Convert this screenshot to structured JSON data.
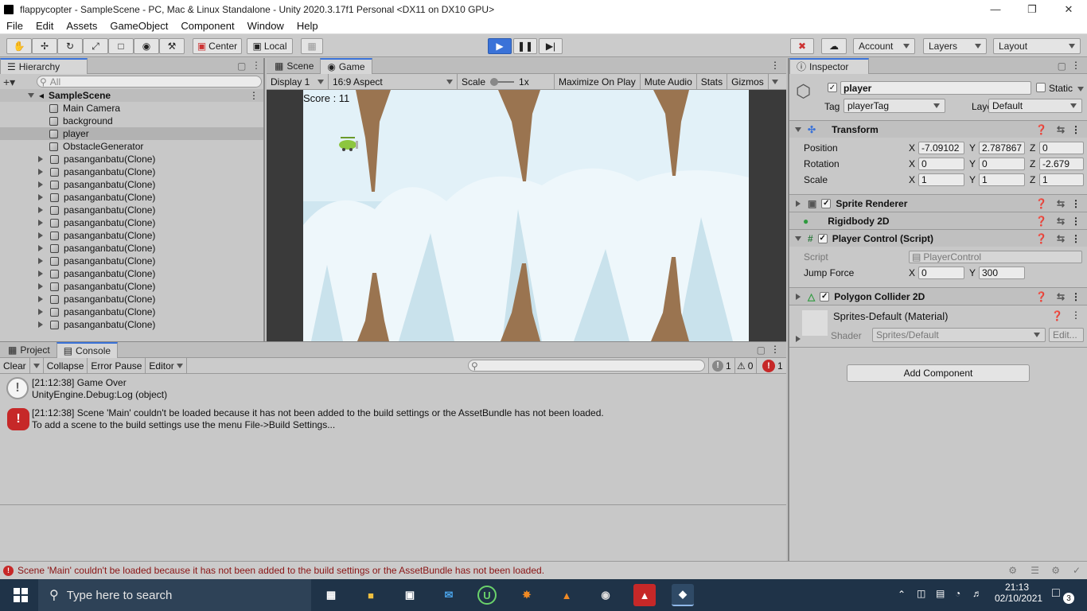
{
  "window": {
    "title": "flappycopter - SampleScene - PC, Mac & Linux Standalone - Unity 2020.3.17f1 Personal <DX11 on DX10 GPU>"
  },
  "menu": [
    "File",
    "Edit",
    "Assets",
    "GameObject",
    "Component",
    "Window",
    "Help"
  ],
  "toolbar": {
    "center": "Center",
    "local": "Local",
    "account": "Account",
    "layers": "Layers",
    "layout": "Layout"
  },
  "hierarchy": {
    "tab": "Hierarchy",
    "search_placeholder": "All",
    "scene": "SampleScene",
    "items": [
      "Main Camera",
      "background",
      "player",
      "ObstacleGenerator"
    ],
    "clones": [
      "pasanganbatu(Clone)",
      "pasanganbatu(Clone)",
      "pasanganbatu(Clone)",
      "pasanganbatu(Clone)",
      "pasanganbatu(Clone)",
      "pasanganbatu(Clone)",
      "pasanganbatu(Clone)",
      "pasanganbatu(Clone)",
      "pasanganbatu(Clone)",
      "pasanganbatu(Clone)",
      "pasanganbatu(Clone)",
      "pasanganbatu(Clone)",
      "pasanganbatu(Clone)",
      "pasanganbatu(Clone)"
    ]
  },
  "game": {
    "tab_scene": "Scene",
    "tab_game": "Game",
    "display": "Display 1",
    "aspect": "16:9 Aspect",
    "scale_label": "Scale",
    "scale_value": "1x",
    "maximize": "Maximize On Play",
    "mute": "Mute Audio",
    "stats": "Stats",
    "gizmos": "Gizmos",
    "score": "Score : 11"
  },
  "console": {
    "tab_project": "Project",
    "tab_console": "Console",
    "clear": "Clear",
    "collapse": "Collapse",
    "error_pause": "Error Pause",
    "editor": "Editor",
    "count_info": "1",
    "count_warn": "0",
    "count_error": "1",
    "logs": [
      {
        "line1": "[21:12:38] Game Over",
        "line2": "UnityEngine.Debug:Log (object)",
        "type": "info"
      },
      {
        "line1": "[21:12:38] Scene 'Main' couldn't be loaded because it has not been added to the build settings or the AssetBundle has not been loaded.",
        "line2": "To add a scene to the build settings use the menu File->Build Settings...",
        "type": "error"
      }
    ]
  },
  "inspector": {
    "tab": "Inspector",
    "name": "player",
    "static": "Static",
    "tag_label": "Tag",
    "tag": "playerTag",
    "layer_label": "Layer",
    "layer": "Default",
    "transform": "Transform",
    "position": "Position",
    "rotation": "Rotation",
    "scale": "Scale",
    "pos": {
      "x": "-7.09102",
      "y": "2.787867",
      "z": "0"
    },
    "rot": {
      "x": "0",
      "y": "0",
      "z": "-2.679"
    },
    "scl": {
      "x": "1",
      "y": "1",
      "z": "1"
    },
    "sprite_renderer": "Sprite Renderer",
    "rigidbody": "Rigidbody 2D",
    "player_control": "Player Control (Script)",
    "script_label": "Script",
    "script": "PlayerControl",
    "jump_label": "Jump Force",
    "jump": {
      "x": "0",
      "y": "300"
    },
    "polygon": "Polygon Collider 2D",
    "material": "Sprites-Default (Material)",
    "shader_label": "Shader",
    "shader": "Sprites/Default",
    "edit": "Edit...",
    "add_component": "Add Component",
    "axis_x": "X",
    "axis_y": "Y",
    "axis_z": "Z"
  },
  "status": {
    "message": "Scene 'Main' couldn't be loaded because it has not been added to the build settings or the AssetBundle has not been loaded."
  },
  "taskbar": {
    "search": "Type here to search",
    "time": "21:13",
    "date": "02/10/2021",
    "notifications": "3"
  }
}
